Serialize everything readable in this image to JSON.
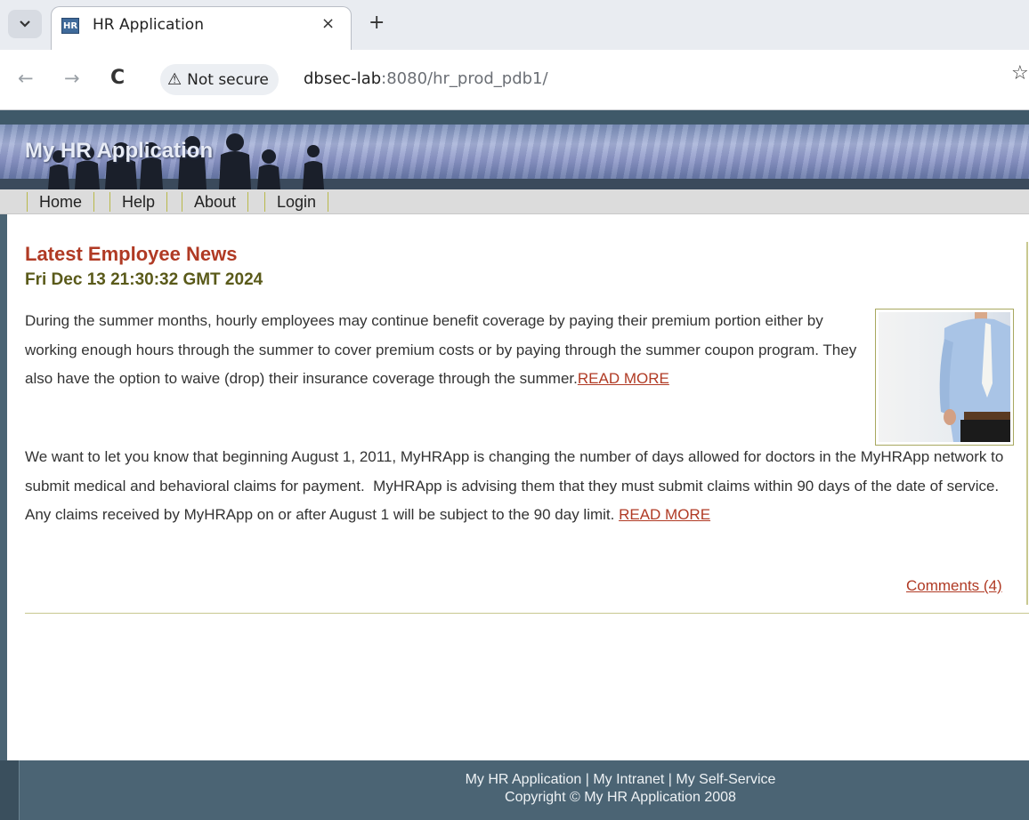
{
  "browser": {
    "tab": {
      "favicon_text": "HR",
      "title": "HR Application",
      "close_glyph": "×"
    },
    "new_tab_glyph": "+",
    "security_label": "Not secure",
    "url_host": "dbsec-lab",
    "url_rest": ":8080/hr_prod_pdb1/",
    "icons": [
      "tab-search-icon",
      "back-arrow-icon",
      "forward-arrow-icon",
      "reload-icon",
      "warning-icon",
      "bookmark-star-icon"
    ]
  },
  "site": {
    "banner_title": "My HR Application",
    "menu": [
      {
        "label": "Home"
      },
      {
        "label": "Help"
      },
      {
        "label": "About"
      },
      {
        "label": "Login"
      }
    ]
  },
  "news": {
    "title": "Latest Employee News",
    "date": "Fri Dec 13 21:30:32 GMT 2024",
    "paragraph1": "During the summer months, hourly employees may continue benefit coverage by paying their premium portion either by working enough hours through the summer to cover premium costs or by paying through the summer coupon program. They also have the option to waive (drop) their insurance coverage through the summer.",
    "paragraph1_link": "READ MORE",
    "paragraph2": "We want to let you know that beginning August 1, 2011, MyHRApp is changing the number of days allowed for doctors in the MyHRApp network to submit medical and behavioral claims for payment.  MyHRApp is advising them that they must submit claims within 90 days of the date of service.  Any claims received by MyHRApp on or after August 1 will be subject to the 90 day limit. ",
    "paragraph2_link": "READ MORE",
    "comments_link": "Comments (4)"
  },
  "footer": {
    "links": "My HR Application | My Intranet | My Self-Service",
    "copyright": "Copyright © My HR Application 2008"
  },
  "colors": {
    "accent_red": "#b03a24",
    "date_olive": "#5a5a1a",
    "footer_bg": "#4b6474"
  }
}
